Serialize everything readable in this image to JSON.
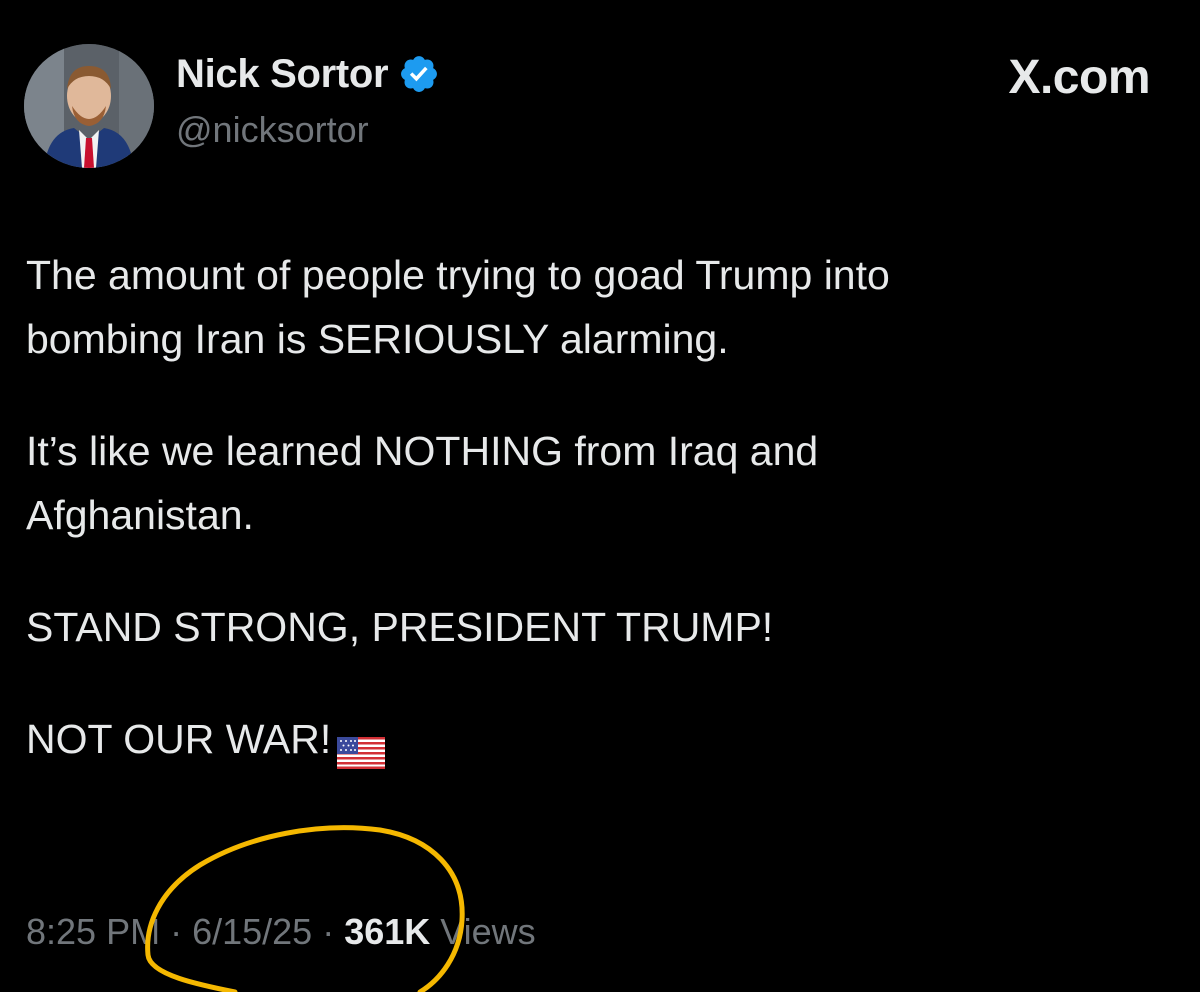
{
  "post": {
    "author": {
      "display_name": "Nick Sortor",
      "handle": "@nicksortor",
      "verified": true,
      "verified_icon": "verified-badge-icon"
    },
    "brand": "X.com",
    "paragraphs": [
      "The amount of people trying to goad Trump into\nbombing Iran is SERIOUSLY alarming.",
      "It’s like we learned NOTHING from Iraq and\nAfghanistan.",
      "STAND STRONG, PRESIDENT TRUMP!",
      "NOT OUR WAR!"
    ],
    "emoji": "us-flag-icon",
    "meta": {
      "time": "8:25 PM",
      "sep1": " · ",
      "date": "6/15/25",
      "sep2": " · ",
      "views_count": "361K",
      "views_label": " Views"
    }
  },
  "colors": {
    "background": "#000000",
    "text": "#e7e9ea",
    "muted": "#71767b",
    "verified": "#1d9bf0",
    "annotation": "#f5b800"
  }
}
